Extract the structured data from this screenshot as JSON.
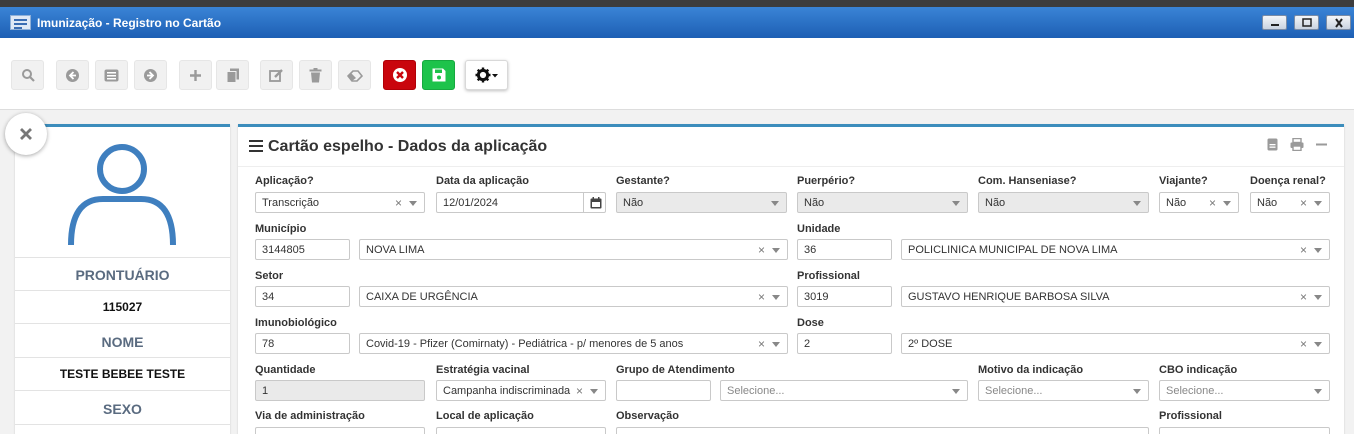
{
  "window": {
    "title": "Imunização - Registro no Cartão"
  },
  "toolbar": {
    "buttons": [
      {
        "name": "search-button",
        "icon": "search-icon"
      },
      {
        "name": "previous-button",
        "icon": "arrow-left-circle-icon"
      },
      {
        "name": "list-button",
        "icon": "list-icon"
      },
      {
        "name": "next-button",
        "icon": "arrow-right-circle-icon"
      },
      {
        "name": "add-button",
        "icon": "plus-icon"
      },
      {
        "name": "copy-button",
        "icon": "copy-icon"
      },
      {
        "name": "edit-button",
        "icon": "edit-icon"
      },
      {
        "name": "delete-button",
        "icon": "trash-icon"
      },
      {
        "name": "clear-button",
        "icon": "eraser-icon"
      },
      {
        "name": "cancel-button",
        "icon": "close-circle-icon"
      },
      {
        "name": "save-button",
        "icon": "save-icon"
      },
      {
        "name": "settings-button",
        "icon": "gear-icon"
      }
    ],
    "colors": {
      "cancel": "#c9050d",
      "save": "#1dc34b"
    }
  },
  "profile": {
    "prontuario_label": "PRONTUÁRIO",
    "prontuario_value": "115027",
    "nome_label": "NOME",
    "nome_value": "TESTE BEBEE TESTE",
    "sexo_label": "SEXO"
  },
  "panel": {
    "title": "Cartão espelho - Dados da aplicação",
    "accent": "#3c8dbc"
  },
  "form": {
    "aplicacao": {
      "label": "Aplicação?",
      "value": "Transcrição"
    },
    "data_aplicacao": {
      "label": "Data da aplicação",
      "value": "12/01/2024"
    },
    "gestante": {
      "label": "Gestante?",
      "value": "Não"
    },
    "puerperio": {
      "label": "Puerpério?",
      "value": "Não"
    },
    "hanseniase": {
      "label": "Com. Hanseniase?",
      "value": "Não"
    },
    "viajante": {
      "label": "Viajante?",
      "value": "Não"
    },
    "doenca_renal": {
      "label": "Doença renal?",
      "value": "Não"
    },
    "municipio": {
      "label": "Município",
      "code": "3144805",
      "value": "NOVA LIMA"
    },
    "unidade": {
      "label": "Unidade",
      "code": "36",
      "value": "POLICLINICA MUNICIPAL DE NOVA LIMA"
    },
    "setor": {
      "label": "Setor",
      "code": "34",
      "value": "CAIXA DE URGÊNCIA"
    },
    "profissional": {
      "label": "Profissional",
      "code": "3019",
      "value": "GUSTAVO HENRIQUE BARBOSA SILVA"
    },
    "imunobiologico": {
      "label": "Imunobiológico",
      "code": "78",
      "value": "Covid-19 - Pfizer (Comirnaty) - Pediátrica - p/ menores de 5 anos"
    },
    "dose": {
      "label": "Dose",
      "code": "2",
      "value": "2º DOSE"
    },
    "quantidade": {
      "label": "Quantidade",
      "value": "1"
    },
    "estrategia": {
      "label": "Estratégia vacinal",
      "value": "Campanha indiscriminada"
    },
    "grupo": {
      "label": "Grupo de Atendimento",
      "code": "",
      "placeholder": "Selecione..."
    },
    "motivo": {
      "label": "Motivo da indicação",
      "placeholder": "Selecione..."
    },
    "cbo": {
      "label": "CBO indicação",
      "placeholder": "Selecione..."
    },
    "via": {
      "label": "Via de administração"
    },
    "local": {
      "label": "Local de aplicação"
    },
    "observacao": {
      "label": "Observação"
    },
    "profissional2": {
      "label": "Profissional"
    }
  }
}
